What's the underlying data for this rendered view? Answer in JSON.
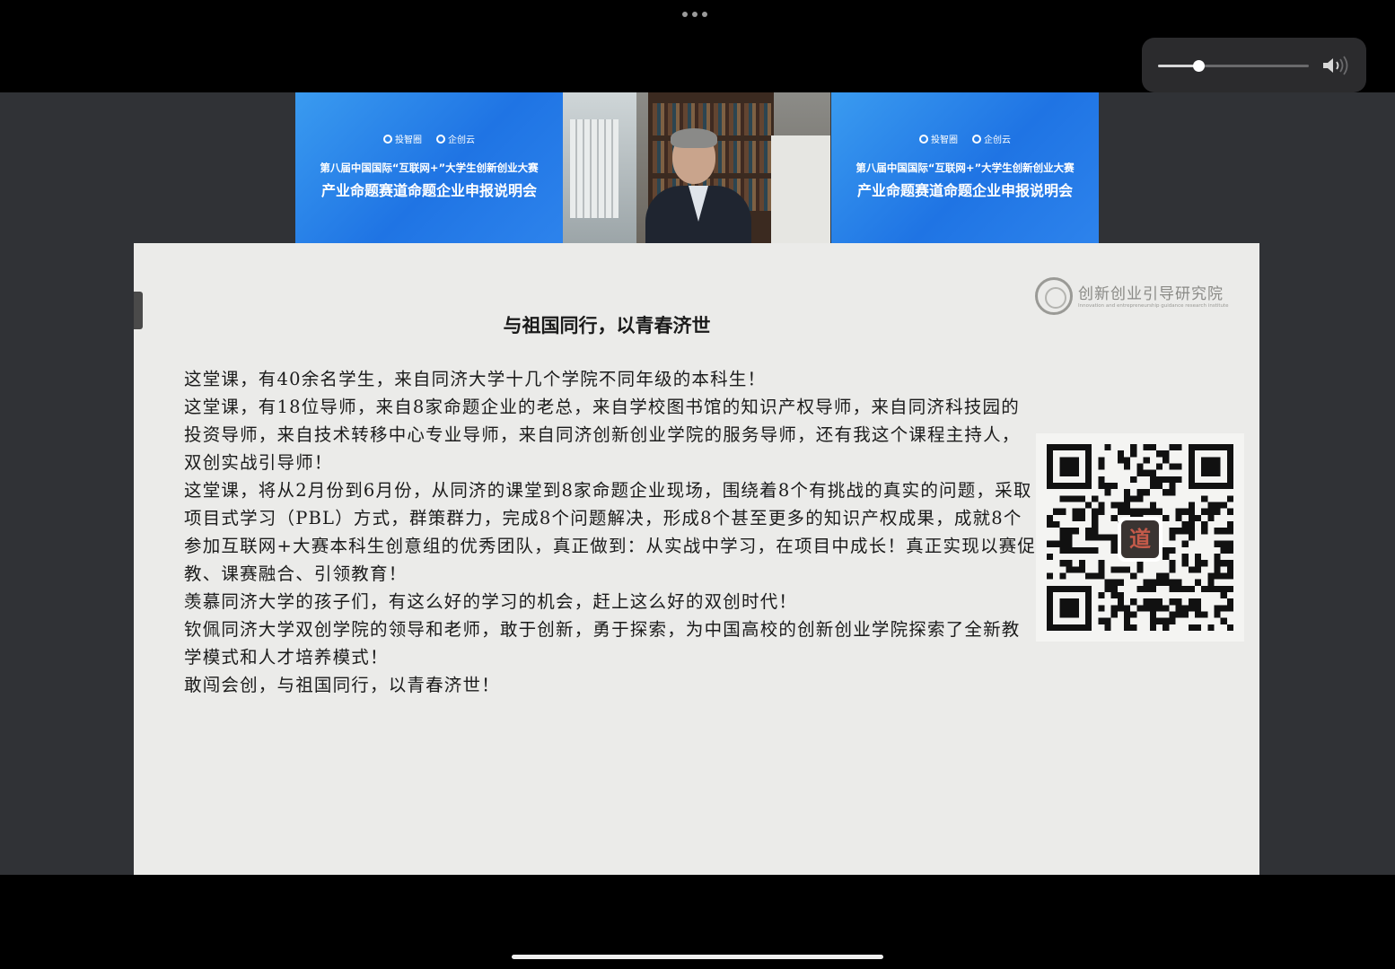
{
  "top_bar": {
    "more_icon": "ellipsis-icon",
    "volume": {
      "level": 0.27,
      "icon": "speaker-icon"
    }
  },
  "video_tiles": {
    "left_banner": {
      "logo_1": "投智圈",
      "logo_2": "企创云",
      "line1": "第八届中国国际“互联网+”大学生创新创业大赛",
      "line2": "产业命题赛道命题企业申报说明会"
    },
    "right_banner": {
      "logo_1": "投智圈",
      "logo_2": "企创云",
      "line1": "第八届中国国际“互联网+”大学生创新创业大赛",
      "line2": "产业命题赛道命题企业申报说明会"
    }
  },
  "slide": {
    "institute_name": "创新创业引导研究院",
    "institute_subtitle": "Innovation and entrepreneurship guidance research institute",
    "title": "与祖国同行，以青春济世",
    "paragraphs": [
      "这堂课，有40余名学生，来自同济大学十几个学院不同年级的本科生！",
      "这堂课，有18位导师，来自8家命题企业的老总，来自学校图书馆的知识产权导师，来自同济科技园的投资导师，来自技术转移中心专业导师，来自同济创新创业学院的服务导师，还有我这个课程主持人，双创实战引导师！",
      "这堂课，将从2月份到6月份，从同济的课堂到8家命题企业现场，围绕着8个有挑战的真实的问题，采取项目式学习（PBL）方式，群策群力，完成8个问题解决，形成8个甚至更多的知识产权成果，成就8个参加互联网+大赛本科生创意组的优秀团队，真正做到：从实战中学习，在项目中成长！真正实现以赛促教、课赛融合、引领教育！",
      "羡慕同济大学的孩子们，有这么好的学习的机会，赶上这么好的双创时代！",
      "钦佩同济大学双创学院的领导和老师，敢于创新，勇于探索，为中国高校的创新创业学院探索了全新教学模式和人才培养模式！",
      "敢闯会创，与祖国同行，以青春济世！"
    ],
    "qr_badge_char": "道"
  }
}
